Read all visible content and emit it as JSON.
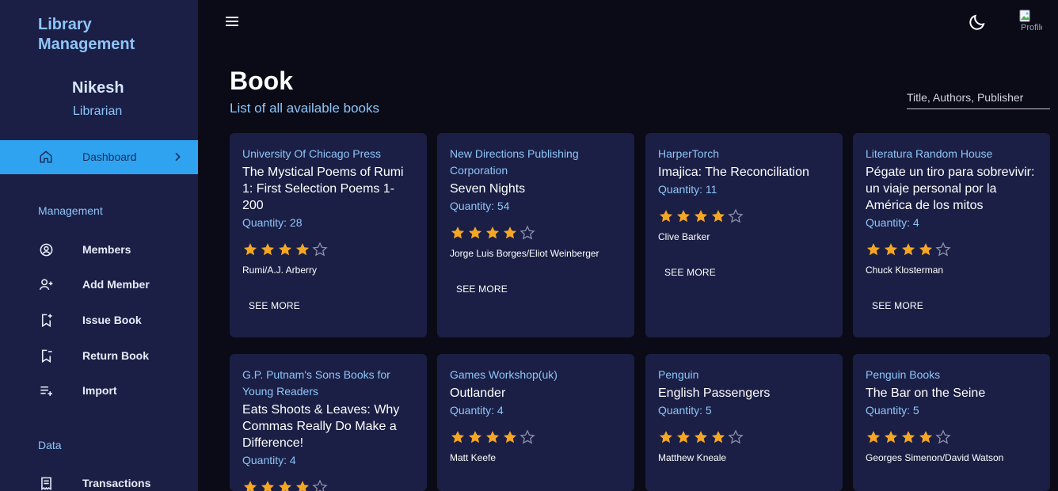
{
  "sidebar": {
    "brand": "Library Management",
    "user_name": "Nikesh",
    "user_role": "Librarian",
    "active_item": "Dashboard",
    "sections": [
      {
        "label": "Management",
        "items": [
          "Members",
          "Add Member",
          "Issue Book",
          "Return Book",
          "Import"
        ]
      },
      {
        "label": "Data",
        "items": [
          "Transactions"
        ]
      }
    ]
  },
  "topbar": {
    "avatar_alt": "Profile"
  },
  "header": {
    "title": "Book",
    "subtitle": "List of all available books",
    "search_placeholder": "Title, Authors, Publisher"
  },
  "books": [
    {
      "publisher": "University Of Chicago Press",
      "title": "The Mystical Poems of Rumi 1: First Selection Poems 1-200",
      "quantity": "Quantity: 28",
      "rating": 4,
      "author": "Rumi/A.J. Arberry",
      "action": "SEE MORE"
    },
    {
      "publisher": "New Directions Publishing Corporation",
      "title": "Seven Nights",
      "quantity": "Quantity: 54",
      "rating": 4,
      "author": "Jorge Luis Borges/Eliot Weinberger",
      "action": "SEE MORE"
    },
    {
      "publisher": "HarperTorch",
      "title": "Imajica: The Reconciliation",
      "quantity": "Quantity: 11",
      "rating": 4,
      "author": "Clive Barker",
      "action": "SEE MORE"
    },
    {
      "publisher": "Literatura Random House",
      "title": "Pégate un tiro para sobrevivir: un viaje personal por la América de los mitos",
      "quantity": "Quantity: 4",
      "rating": 4,
      "author": "Chuck Klosterman",
      "action": "SEE MORE"
    },
    {
      "publisher": "G.P. Putnam's Sons Books for Young Readers",
      "title": "Eats Shoots & Leaves: Why Commas Really Do Make a Difference!",
      "quantity": "Quantity: 4",
      "rating": 4,
      "author": "",
      "action": ""
    },
    {
      "publisher": "Games Workshop(uk)",
      "title": "Outlander",
      "quantity": "Quantity: 4",
      "rating": 4,
      "author": "Matt Keefe",
      "action": ""
    },
    {
      "publisher": "Penguin",
      "title": "English Passengers",
      "quantity": "Quantity: 5",
      "rating": 4,
      "author": "Matthew Kneale",
      "action": ""
    },
    {
      "publisher": "Penguin Books",
      "title": "The Bar on the Seine",
      "quantity": "Quantity: 5",
      "rating": 4,
      "author": "Georges Simenon/David Watson",
      "action": ""
    }
  ],
  "colors": {
    "accent": "#2fa3f0",
    "star": "#f5a623",
    "card_bg": "#1b1f45",
    "page_bg": "#0a0b17"
  }
}
